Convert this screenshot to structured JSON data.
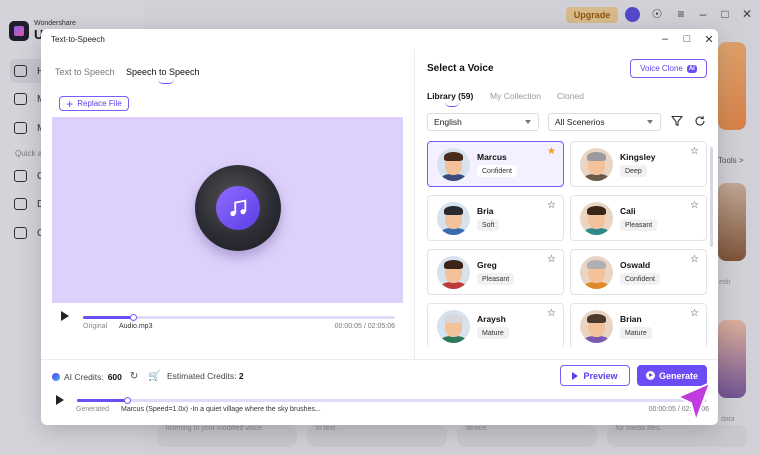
{
  "app": {
    "brand_top": "Wondershare",
    "brand_bottom": "U",
    "upgrade_label": "Upgrade",
    "sidebar": {
      "items": [
        {
          "label": "H",
          "icon": "home-icon"
        },
        {
          "label": "M",
          "icon": "media-icon"
        },
        {
          "label": "M",
          "icon": "document-icon"
        }
      ],
      "quick_label": "Quick a",
      "quick_items": [
        {
          "label": "C",
          "icon": "convert-icon"
        },
        {
          "label": "D",
          "icon": "download-icon"
        },
        {
          "label": "C",
          "icon": "screen-icon"
        }
      ]
    },
    "bg_text": {
      "tools": "Tools >",
      "edit": "edit",
      "caption_1": "listening to your modified voice.",
      "caption_2": "to text.",
      "caption_3": "device.",
      "caption_4": "for media files.",
      "caption_5": "data"
    }
  },
  "dialog": {
    "title": "Text-to-Speech",
    "tabs": [
      {
        "label": "Text to Speech",
        "active": false
      },
      {
        "label": "Speech to Speech",
        "active": true
      }
    ],
    "replace_file_label": "Replace File",
    "original_player": {
      "label": "Original",
      "file": "Audio.mp3",
      "time": "00:00:05 / 02:05:06",
      "progress": 0.16
    },
    "voice_panel": {
      "title": "Select a Voice",
      "voice_clone_label": "Voice Clone",
      "voice_clone_badge": "AI",
      "tabs": [
        {
          "label": "Library (59)",
          "active": true
        },
        {
          "label": "My Collection",
          "active": false
        },
        {
          "label": "Cloned",
          "active": false
        }
      ],
      "language": "English",
      "scenario": "All Scenerios",
      "voices": [
        {
          "name": "Marcus",
          "tag": "Confident",
          "favorite": true,
          "selected": true,
          "hair": "#4a2c1c",
          "shirt": "#3a4a7a"
        },
        {
          "name": "Kingsley",
          "tag": "Deep",
          "favorite": false,
          "selected": false,
          "hair": "#9a9aa0",
          "shirt": "#6a5a4a"
        },
        {
          "name": "Bria",
          "tag": "Soft",
          "favorite": false,
          "selected": false,
          "hair": "#2a2a2e",
          "shirt": "#3a6ab0"
        },
        {
          "name": "Cali",
          "tag": "Pleasant",
          "favorite": false,
          "selected": false,
          "hair": "#3a2418",
          "shirt": "#2c8a8a"
        },
        {
          "name": "Greg",
          "tag": "Pleasant",
          "favorite": false,
          "selected": false,
          "hair": "#3a2418",
          "shirt": "#c03a3a"
        },
        {
          "name": "Oswald",
          "tag": "Confident",
          "favorite": false,
          "selected": false,
          "hair": "#b0b0b4",
          "shirt": "#e08a2a"
        },
        {
          "name": "Araysh",
          "tag": "Mature",
          "favorite": false,
          "selected": false,
          "hair": "#d8d8dc",
          "shirt": "#2c7a5a"
        },
        {
          "name": "Brian",
          "tag": "Mature",
          "favorite": false,
          "selected": false,
          "hair": "#4a3a2e",
          "shirt": "#7a5ab0"
        }
      ]
    },
    "credits": {
      "label": "AI Credits:",
      "value": "600",
      "estimated_label": "Estimated Credits:",
      "estimated_value": "2"
    },
    "preview_label": "Preview",
    "generate_label": "Generate",
    "generated_player": {
      "label": "Generated",
      "text": "Marcus (Speed=1.0x) -In a quiet village where the sky brushes...",
      "time": "00:00:05 / 02:05:06",
      "progress": 0.08
    }
  },
  "colors": {
    "accent": "#6c4cf5",
    "accent_light": "#ddd1fb",
    "upgrade_bg": "#f0cf96",
    "favorite_star": "#f29b1d"
  }
}
